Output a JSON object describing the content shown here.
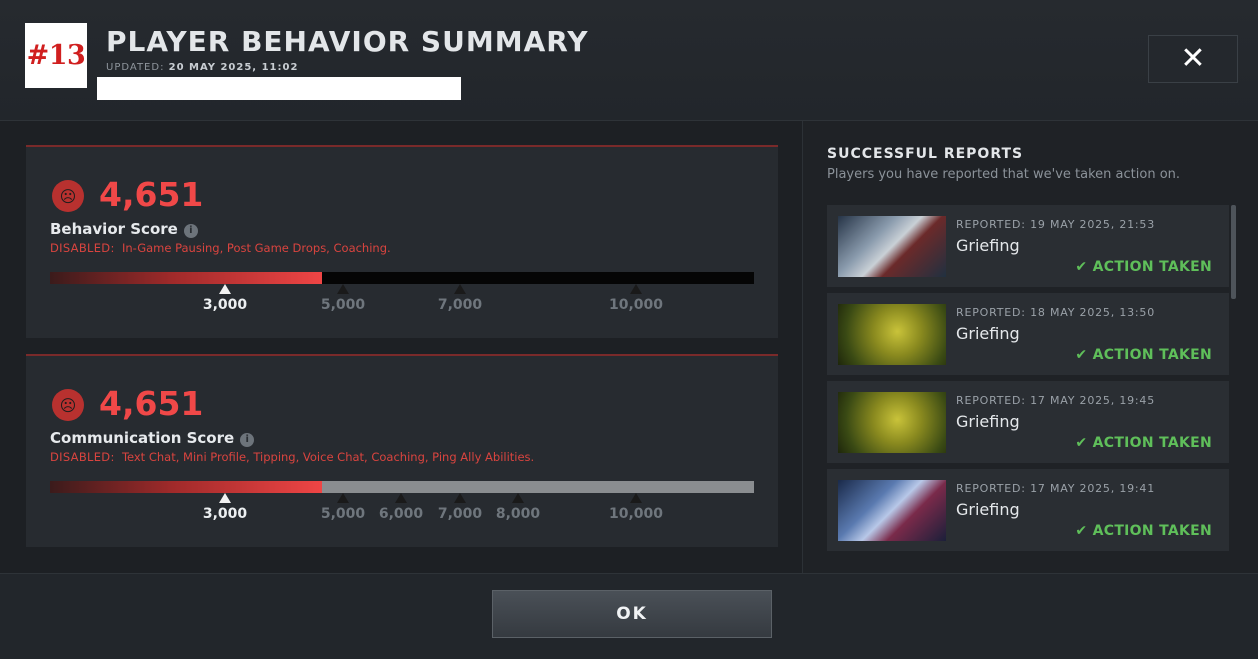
{
  "header": {
    "rank_badge": "#13",
    "title": "PLAYER BEHAVIOR SUMMARY",
    "updated_label": "UPDATED:",
    "updated_value": "20 MAY 2025, 11:02",
    "close_icon": "close-icon"
  },
  "behavior": {
    "score": "4,651",
    "label": "Behavior Score",
    "disabled_prefix": "DISABLED:",
    "disabled_list": "In-Game Pausing, Post Game Drops, Coaching.",
    "progress_fraction": 0.386,
    "current_marker": "3,000",
    "ticks": [
      "5,000",
      "7,000",
      "10,000"
    ]
  },
  "communication": {
    "score": "4,651",
    "label": "Communication Score",
    "disabled_prefix": "DISABLED:",
    "disabled_list": "Text Chat, Mini Profile, Tipping, Voice Chat, Coaching, Ping Ally Abilities.",
    "progress_fraction": 0.386,
    "current_marker": "3,000",
    "ticks": [
      "5,000",
      "6,000",
      "7,000",
      "8,000",
      "10,000"
    ]
  },
  "reports": {
    "title": "SUCCESSFUL REPORTS",
    "subtitle": "Players you have reported that we've taken action on.",
    "items": [
      {
        "reported": "REPORTED: 19 MAY 2025, 21:53",
        "reason": "Griefing",
        "status": "ACTION TAKEN"
      },
      {
        "reported": "REPORTED: 18 MAY 2025, 13:50",
        "reason": "Griefing",
        "status": "ACTION TAKEN"
      },
      {
        "reported": "REPORTED: 17 MAY 2025, 19:45",
        "reason": "Griefing",
        "status": "ACTION TAKEN"
      },
      {
        "reported": "REPORTED: 17 MAY 2025, 19:41",
        "reason": "Griefing",
        "status": "ACTION TAKEN"
      }
    ]
  },
  "footer": {
    "ok_label": "OK"
  },
  "colors": {
    "accent_red": "#f04848",
    "action_green": "#5fbf5a"
  }
}
